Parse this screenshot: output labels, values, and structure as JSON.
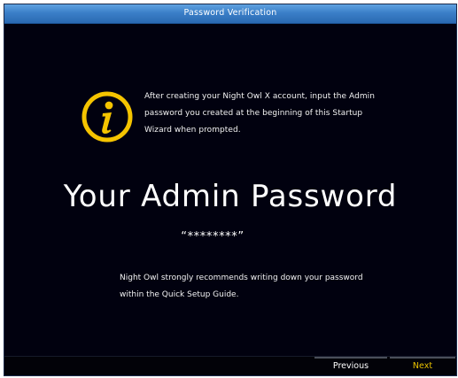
{
  "window": {
    "title": "Password Verification"
  },
  "info": {
    "icon": "info-icon",
    "icon_color": "#f5c400",
    "lines": [
      "After creating your Night Owl X account, input the Admin",
      "password you created at the beginning of this Startup",
      "Wizard when prompted."
    ]
  },
  "headline": "Your Admin Password",
  "password_display": "“********”",
  "note": {
    "lines": [
      "Night Owl strongly recommends writing down your password",
      "within the Quick Setup Guide."
    ]
  },
  "footer": {
    "previous_label": "Previous",
    "next_label": "Next"
  },
  "colors": {
    "background": "#01010f",
    "titlebar": "#3b7fc8",
    "next_accent": "#e8c000"
  }
}
